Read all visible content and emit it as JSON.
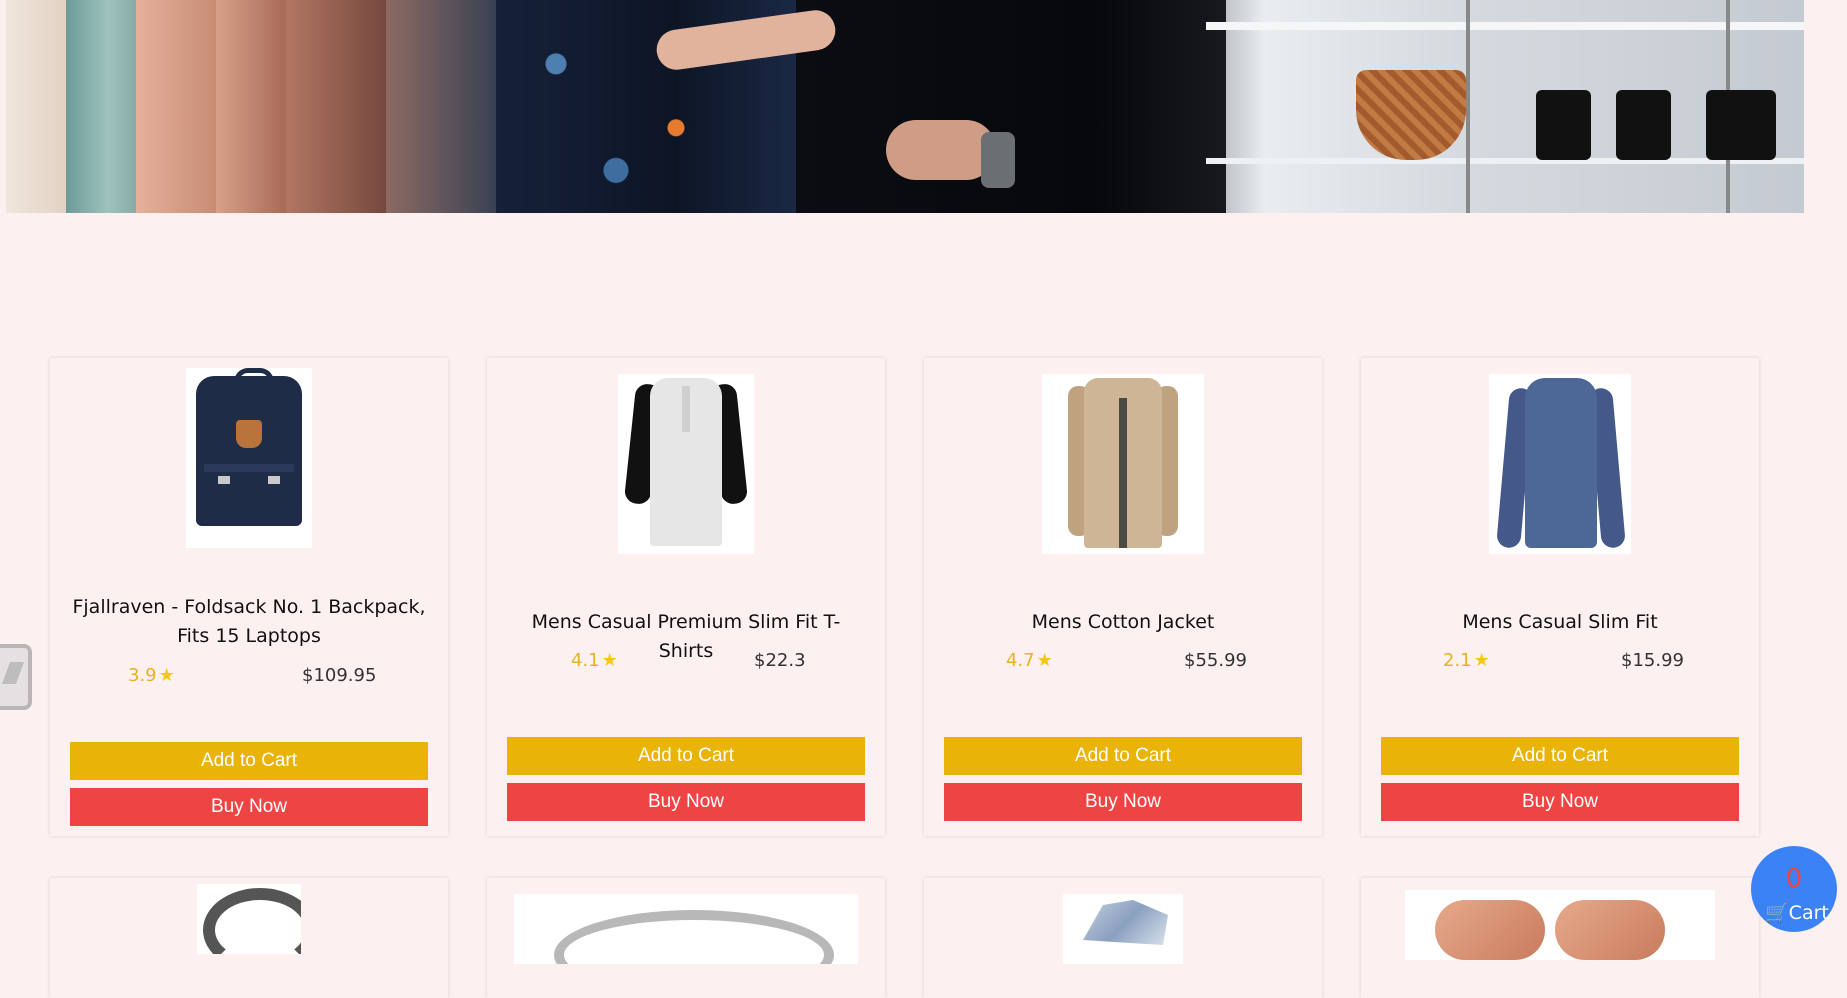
{
  "cart": {
    "count": "0",
    "label": "Cart",
    "icon": "cart-icon"
  },
  "products_row1": [
    {
      "title": "Fjallraven - Foldsack No. 1 Backpack, Fits 15 Laptops",
      "rating": "3.9",
      "price": "$109.95",
      "add_label": "Add to Cart",
      "buy_label": "Buy Now"
    },
    {
      "title": "Mens Casual Premium Slim Fit T-Shirts",
      "rating": "4.1",
      "price": "$22.3",
      "add_label": "Add to Cart",
      "buy_label": "Buy Now"
    },
    {
      "title": "Mens Cotton Jacket",
      "rating": "4.7",
      "price": "$55.99",
      "add_label": "Add to Cart",
      "buy_label": "Buy Now"
    },
    {
      "title": "Mens Casual Slim Fit",
      "rating": "2.1",
      "price": "$15.99",
      "add_label": "Add to Cart",
      "buy_label": "Buy Now"
    }
  ],
  "colors": {
    "page_bg": "#fdf0f1",
    "add_to_cart": "#eab308",
    "buy_now": "#ef4444",
    "rating": "#e6b31e",
    "cart_bubble": "#3b82f6"
  }
}
